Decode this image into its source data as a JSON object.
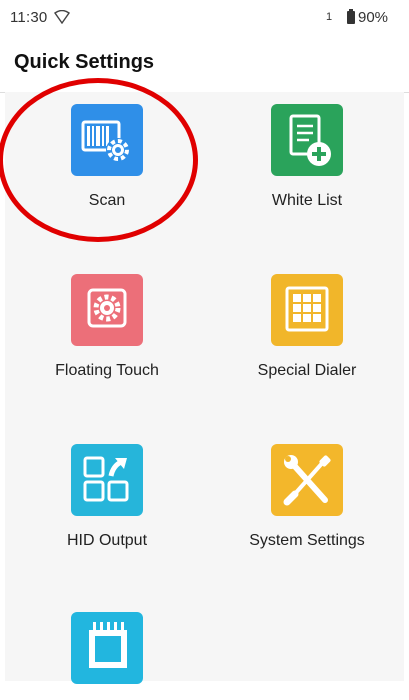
{
  "status": {
    "time": "11:30",
    "sim": "1",
    "battery": "90%"
  },
  "appbar": {
    "title": "Quick Settings"
  },
  "tiles": [
    {
      "label": "Scan",
      "icon": "barcode-scan-gear-icon",
      "color": "#2f8fe8"
    },
    {
      "label": "White List",
      "icon": "checklist-plus-icon",
      "color": "#2aa35b"
    },
    {
      "label": "Floating Touch",
      "icon": "gear-icon",
      "color": "#ec6f79"
    },
    {
      "label": "Special Dialer",
      "icon": "grid-dialer-icon",
      "color": "#f1b62a"
    },
    {
      "label": "HID Output",
      "icon": "squares-arrow-icon",
      "color": "#26b5da"
    },
    {
      "label": "System Settings",
      "icon": "wrench-screwdriver-icon",
      "color": "#f3b72b"
    },
    {
      "label": "",
      "icon": "chip-icon",
      "color": "#22b6df"
    }
  ],
  "highlight": {
    "color": "#e00000",
    "target": "Scan"
  }
}
